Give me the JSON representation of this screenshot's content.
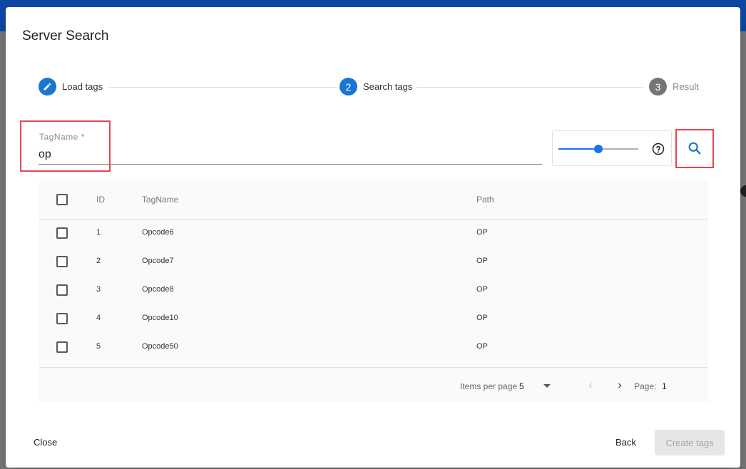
{
  "dialog": {
    "title": "Server Search"
  },
  "stepper": {
    "steps": [
      {
        "number": "1",
        "label": "Load tags",
        "state": "edit"
      },
      {
        "number": "2",
        "label": "Search tags",
        "state": "active"
      },
      {
        "number": "3",
        "label": "Result",
        "state": "pending"
      }
    ]
  },
  "search_form": {
    "tagname_label": "TagName *",
    "tagname_value": "op",
    "slider_value": 0.5,
    "help_icon": "help-circle-icon",
    "search_icon": "search-icon"
  },
  "table": {
    "columns": [
      "ID",
      "TagName",
      "Path"
    ],
    "rows": [
      {
        "id": "1",
        "tagname": "Opcode6",
        "path": "OP"
      },
      {
        "id": "2",
        "tagname": "Opcode7",
        "path": "OP"
      },
      {
        "id": "3",
        "tagname": "Opcode8",
        "path": "OP"
      },
      {
        "id": "4",
        "tagname": "Opcode10",
        "path": "OP"
      },
      {
        "id": "5",
        "tagname": "Opcode50",
        "path": "OP"
      }
    ],
    "paginator": {
      "items_per_page_label": "Items per page",
      "items_per_page_value": "5",
      "page_label": "Page:",
      "page_value": "1"
    }
  },
  "actions": {
    "close": "Close",
    "back": "Back",
    "create_tags": "Create tags"
  },
  "colors": {
    "accent": "#1976d2",
    "highlight": "#e0484f"
  }
}
